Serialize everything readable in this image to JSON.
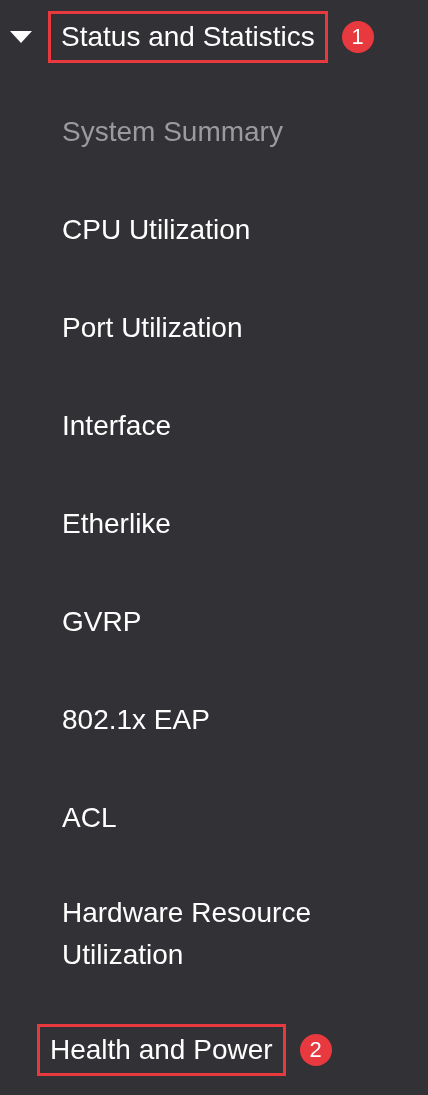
{
  "menu": {
    "title": "Status and Statistics",
    "expanded": true,
    "callout": "1",
    "items": [
      {
        "label": "System Summary",
        "selected": true
      },
      {
        "label": "CPU Utilization",
        "selected": false
      },
      {
        "label": "Port Utilization",
        "selected": false
      },
      {
        "label": "Interface",
        "selected": false
      },
      {
        "label": "Etherlike",
        "selected": false
      },
      {
        "label": "GVRP",
        "selected": false
      },
      {
        "label": "802.1x EAP",
        "selected": false
      },
      {
        "label": "ACL",
        "selected": false
      },
      {
        "label": "Hardware Resource Utilization",
        "selected": false
      },
      {
        "label": "Health and Power",
        "selected": false,
        "callout": "2"
      }
    ]
  }
}
